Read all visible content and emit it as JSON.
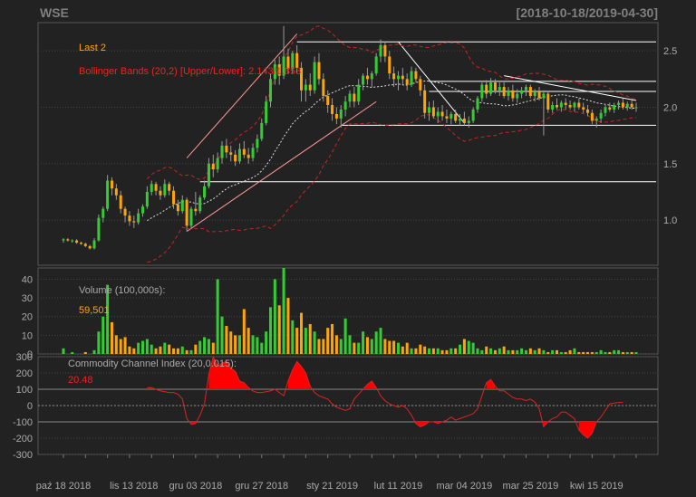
{
  "header": {
    "symbol": "WSE",
    "range": "[2018-10-18/2019-04-30]"
  },
  "colors": {
    "background": "#222222",
    "panel": "#222222",
    "grid": "#444444",
    "frame": "#555555",
    "text": "#aaaaaa",
    "up": "#33cc33",
    "down": "#ffa500",
    "bb": "#cc2222",
    "ma": "#dddddd",
    "label_orange": "#ffa500",
    "label_red": "#ee2222",
    "cci_fill": "#ff0000",
    "cci_line": "#dd2222",
    "trendline": "#ffffff"
  },
  "chart_data": [
    {
      "type": "candlestick",
      "panel": "price",
      "legend": {
        "last_label": "Last 2",
        "bb_label": "Bollinger Bands (20,2) [Upper/Lower]: 2.143/1.853"
      },
      "ylim": [
        0.6,
        2.75
      ],
      "yticks": [
        1.0,
        1.5,
        2.0,
        2.5
      ],
      "ytick_labels": [
        "1.0",
        "1.5",
        "2.0",
        "2.5"
      ],
      "hlines": [
        2.58,
        2.23,
        2.14,
        1.84,
        1.34
      ],
      "trend_lines": [
        {
          "x0": "2018-11-29",
          "y0": 1.55,
          "x1": "2019-01-09",
          "y1": 2.65
        },
        {
          "x0": "2018-11-29",
          "y0": 0.9,
          "x1": "2019-02-04",
          "y1": 2.05
        },
        {
          "x0": "2019-02-11",
          "y0": 2.58,
          "x1": "2019-03-04",
          "y1": 1.86
        },
        {
          "x0": "2019-03-15",
          "y0": 2.28,
          "x1": "2019-04-30",
          "y1": 2.06
        }
      ],
      "bars": [
        [
          "2018-10-18",
          0.82,
          0.84,
          0.8,
          0.83
        ],
        [
          "2018-10-19",
          0.83,
          0.84,
          0.81,
          0.82
        ],
        [
          "2018-10-22",
          0.82,
          0.83,
          0.8,
          0.82
        ],
        [
          "2018-10-23",
          0.82,
          0.83,
          0.79,
          0.8
        ],
        [
          "2018-10-24",
          0.8,
          0.81,
          0.78,
          0.79
        ],
        [
          "2018-10-25",
          0.79,
          0.8,
          0.76,
          0.77
        ],
        [
          "2018-10-26",
          0.77,
          0.78,
          0.74,
          0.75
        ],
        [
          "2018-10-29",
          0.75,
          0.84,
          0.74,
          0.82
        ],
        [
          "2018-10-30",
          0.82,
          1.05,
          0.81,
          1.02
        ],
        [
          "2018-10-31",
          1.02,
          1.12,
          0.98,
          1.1
        ],
        [
          "2018-11-02",
          1.1,
          1.4,
          1.08,
          1.35
        ],
        [
          "2018-11-05",
          1.35,
          1.38,
          1.22,
          1.28
        ],
        [
          "2018-11-06",
          1.28,
          1.32,
          1.18,
          1.22
        ],
        [
          "2018-11-07",
          1.22,
          1.26,
          1.06,
          1.1
        ],
        [
          "2018-11-08",
          1.1,
          1.12,
          0.98,
          1.04
        ],
        [
          "2018-11-09",
          1.04,
          1.08,
          0.95,
          0.99
        ],
        [
          "2018-11-13",
          0.99,
          1.04,
          0.93,
          0.98
        ],
        [
          "2018-11-14",
          0.98,
          1.1,
          0.96,
          1.06
        ],
        [
          "2018-11-15",
          1.06,
          1.14,
          1.03,
          1.12
        ],
        [
          "2018-11-16",
          1.12,
          1.3,
          1.1,
          1.25
        ],
        [
          "2018-11-19",
          1.25,
          1.35,
          1.22,
          1.32
        ],
        [
          "2018-11-20",
          1.32,
          1.34,
          1.22,
          1.26
        ],
        [
          "2018-11-21",
          1.26,
          1.3,
          1.18,
          1.22
        ],
        [
          "2018-11-22",
          1.22,
          1.36,
          1.2,
          1.32
        ],
        [
          "2018-11-23",
          1.32,
          1.34,
          1.22,
          1.26
        ],
        [
          "2018-11-26",
          1.26,
          1.3,
          1.1,
          1.14
        ],
        [
          "2018-11-27",
          1.14,
          1.18,
          1.04,
          1.08
        ],
        [
          "2018-11-28",
          1.08,
          1.22,
          1.06,
          1.18
        ],
        [
          "2018-11-29",
          1.18,
          1.2,
          0.9,
          0.95
        ],
        [
          "2018-11-30",
          0.95,
          1.12,
          0.92,
          1.1
        ],
        [
          "2018-12-03",
          1.1,
          1.25,
          1.04,
          1.08
        ],
        [
          "2018-12-04",
          1.08,
          1.22,
          1.06,
          1.2
        ],
        [
          "2018-12-05",
          1.2,
          1.35,
          1.18,
          1.3
        ],
        [
          "2018-12-06",
          1.3,
          1.55,
          1.28,
          1.5
        ],
        [
          "2018-12-07",
          1.5,
          1.58,
          1.38,
          1.45
        ],
        [
          "2018-12-10",
          1.45,
          1.6,
          1.42,
          1.55
        ],
        [
          "2018-12-11",
          1.55,
          1.7,
          1.5,
          1.66
        ],
        [
          "2018-12-12",
          1.66,
          1.72,
          1.55,
          1.6
        ],
        [
          "2018-12-13",
          1.6,
          1.66,
          1.52,
          1.58
        ],
        [
          "2018-12-14",
          1.58,
          1.62,
          1.48,
          1.52
        ],
        [
          "2018-12-17",
          1.52,
          1.68,
          1.5,
          1.63
        ],
        [
          "2018-12-18",
          1.63,
          1.7,
          1.55,
          1.58
        ],
        [
          "2018-12-19",
          1.58,
          1.64,
          1.5,
          1.55
        ],
        [
          "2018-12-20",
          1.55,
          1.68,
          1.52,
          1.64
        ],
        [
          "2018-12-21",
          1.64,
          1.76,
          1.6,
          1.72
        ],
        [
          "2018-12-27",
          1.72,
          1.9,
          1.7,
          1.86
        ],
        [
          "2018-12-28",
          1.86,
          2.1,
          1.84,
          2.05
        ],
        [
          "2018-12-31",
          2.05,
          2.3,
          2.0,
          2.25
        ],
        [
          "2019-01-02",
          2.25,
          2.42,
          2.2,
          2.38
        ],
        [
          "2019-01-03",
          2.38,
          2.45,
          2.2,
          2.28
        ],
        [
          "2019-01-04",
          2.28,
          2.72,
          2.25,
          2.45
        ],
        [
          "2019-01-07",
          2.45,
          2.52,
          2.3,
          2.34
        ],
        [
          "2019-01-08",
          2.34,
          2.5,
          2.3,
          2.48
        ],
        [
          "2019-01-09",
          2.48,
          2.55,
          2.3,
          2.35
        ],
        [
          "2019-01-10",
          2.35,
          2.4,
          2.05,
          2.15
        ],
        [
          "2019-01-11",
          2.15,
          2.25,
          2.05,
          2.2
        ],
        [
          "2019-01-14",
          2.2,
          2.3,
          2.1,
          2.15
        ],
        [
          "2019-01-15",
          2.15,
          2.45,
          2.12,
          2.4
        ],
        [
          "2019-01-16",
          2.4,
          2.48,
          2.2,
          2.25
        ],
        [
          "2019-01-17",
          2.25,
          2.3,
          2.05,
          2.1
        ],
        [
          "2019-01-18",
          2.1,
          2.15,
          1.95,
          2.02
        ],
        [
          "2019-01-21",
          2.02,
          2.08,
          1.88,
          1.94
        ],
        [
          "2019-01-22",
          1.94,
          2.0,
          1.85,
          1.9
        ],
        [
          "2019-01-23",
          1.9,
          2.02,
          1.82,
          1.98
        ],
        [
          "2019-01-24",
          1.98,
          2.1,
          1.92,
          2.05
        ],
        [
          "2019-01-25",
          2.05,
          2.15,
          2.0,
          2.12
        ],
        [
          "2019-01-28",
          2.12,
          2.18,
          2.0,
          2.05
        ],
        [
          "2019-01-29",
          2.05,
          2.25,
          2.02,
          2.2
        ],
        [
          "2019-01-30",
          2.2,
          2.3,
          2.15,
          2.28
        ],
        [
          "2019-01-31",
          2.28,
          2.35,
          2.2,
          2.25
        ],
        [
          "2019-02-01",
          2.25,
          2.32,
          2.18,
          2.3
        ],
        [
          "2019-02-04",
          2.3,
          2.48,
          2.28,
          2.45
        ],
        [
          "2019-02-05",
          2.45,
          2.6,
          2.4,
          2.55
        ],
        [
          "2019-02-06",
          2.55,
          2.58,
          2.4,
          2.45
        ],
        [
          "2019-02-07",
          2.45,
          2.5,
          2.25,
          2.3
        ],
        [
          "2019-02-08",
          2.3,
          2.36,
          2.18,
          2.25
        ],
        [
          "2019-02-11",
          2.25,
          2.32,
          2.15,
          2.28
        ],
        [
          "2019-02-12",
          2.28,
          2.35,
          2.2,
          2.25
        ],
        [
          "2019-02-13",
          2.25,
          2.3,
          2.15,
          2.2
        ],
        [
          "2019-02-14",
          2.2,
          2.36,
          2.18,
          2.32
        ],
        [
          "2019-02-15",
          2.32,
          2.35,
          2.22,
          2.25
        ],
        [
          "2019-02-18",
          2.25,
          2.28,
          2.1,
          2.15
        ],
        [
          "2019-02-19",
          2.15,
          2.2,
          1.9,
          1.95
        ],
        [
          "2019-02-20",
          1.95,
          2.05,
          1.88,
          2.0
        ],
        [
          "2019-02-21",
          2.0,
          2.06,
          1.9,
          1.92
        ],
        [
          "2019-02-22",
          1.92,
          2.0,
          1.86,
          1.96
        ],
        [
          "2019-02-25",
          1.96,
          2.02,
          1.88,
          1.92
        ],
        [
          "2019-02-26",
          1.92,
          1.98,
          1.86,
          1.9
        ],
        [
          "2019-02-27",
          1.9,
          1.96,
          1.85,
          1.94
        ],
        [
          "2019-02-28",
          1.94,
          1.98,
          1.86,
          1.88
        ],
        [
          "2019-03-01",
          1.88,
          1.94,
          1.84,
          1.9
        ],
        [
          "2019-03-04",
          1.9,
          1.96,
          1.84,
          1.86
        ],
        [
          "2019-03-05",
          1.86,
          1.92,
          1.82,
          1.88
        ],
        [
          "2019-03-06",
          1.88,
          2.0,
          1.86,
          1.98
        ],
        [
          "2019-03-07",
          1.98,
          2.1,
          1.95,
          2.08
        ],
        [
          "2019-03-08",
          2.08,
          2.22,
          2.05,
          2.2
        ],
        [
          "2019-03-11",
          2.2,
          2.24,
          2.08,
          2.12
        ],
        [
          "2019-03-12",
          2.12,
          2.26,
          2.1,
          2.22
        ],
        [
          "2019-03-13",
          2.22,
          2.25,
          2.12,
          2.15
        ],
        [
          "2019-03-14",
          2.15,
          2.22,
          2.1,
          2.18
        ],
        [
          "2019-03-15",
          2.18,
          2.22,
          2.08,
          2.1
        ],
        [
          "2019-03-18",
          2.1,
          2.18,
          2.06,
          2.15
        ],
        [
          "2019-03-19",
          2.15,
          2.2,
          2.05,
          2.08
        ],
        [
          "2019-03-20",
          2.08,
          2.16,
          2.04,
          2.12
        ],
        [
          "2019-03-21",
          2.12,
          2.18,
          2.08,
          2.15
        ],
        [
          "2019-03-22",
          2.15,
          2.2,
          2.1,
          2.18
        ],
        [
          "2019-03-25",
          2.18,
          2.2,
          2.08,
          2.1
        ],
        [
          "2019-03-26",
          2.1,
          2.16,
          2.05,
          2.14
        ],
        [
          "2019-03-27",
          2.14,
          2.18,
          2.06,
          2.08
        ],
        [
          "2019-03-28",
          2.08,
          2.15,
          1.75,
          2.12
        ],
        [
          "2019-03-29",
          2.12,
          2.14,
          1.95,
          1.98
        ],
        [
          "2019-04-01",
          1.98,
          2.05,
          1.95,
          2.02
        ],
        [
          "2019-04-02",
          2.02,
          2.08,
          1.98,
          2.0
        ],
        [
          "2019-04-03",
          2.0,
          2.06,
          1.96,
          2.04
        ],
        [
          "2019-04-04",
          2.04,
          2.08,
          1.98,
          2.02
        ],
        [
          "2019-04-05",
          2.02,
          2.06,
          1.98,
          2.0
        ],
        [
          "2019-04-08",
          2.0,
          2.05,
          1.96,
          2.04
        ],
        [
          "2019-04-09",
          2.04,
          2.08,
          1.98,
          2.0
        ],
        [
          "2019-04-10",
          2.0,
          2.04,
          1.95,
          1.98
        ],
        [
          "2019-04-11",
          1.98,
          2.02,
          1.92,
          1.95
        ],
        [
          "2019-04-12",
          1.95,
          1.98,
          1.85,
          1.88
        ],
        [
          "2019-04-15",
          1.88,
          1.92,
          1.82,
          1.9
        ],
        [
          "2019-04-16",
          1.9,
          1.98,
          1.86,
          1.95
        ],
        [
          "2019-04-17",
          1.95,
          2.02,
          1.92,
          2.0
        ],
        [
          "2019-04-18",
          2.0,
          2.04,
          1.96,
          1.98
        ],
        [
          "2019-04-23",
          1.98,
          2.04,
          1.95,
          2.02
        ],
        [
          "2019-04-24",
          2.02,
          2.06,
          1.98,
          2.04
        ],
        [
          "2019-04-25",
          2.04,
          2.08,
          1.98,
          2.0
        ],
        [
          "2019-04-26",
          2.0,
          2.05,
          1.97,
          2.03
        ],
        [
          "2019-04-29",
          2.03,
          2.06,
          1.98,
          2.0
        ],
        [
          "2019-04-30",
          2.0,
          2.04,
          1.96,
          2.0
        ]
      ]
    },
    {
      "type": "bar",
      "panel": "volume",
      "label": "Volume (100,000s):",
      "last_value": "59,501",
      "ylim": [
        0,
        46
      ],
      "yticks": [
        0,
        10,
        20,
        30,
        40
      ],
      "ytick_labels": [
        "0",
        "10",
        "20",
        "30",
        "40"
      ],
      "values": [
        3,
        0,
        1,
        0,
        0,
        1,
        0,
        2,
        12,
        20,
        37,
        17,
        10,
        8,
        9,
        4,
        3,
        6,
        7,
        8,
        5,
        3,
        4,
        6,
        5,
        3,
        3,
        4,
        2,
        2,
        5,
        7,
        9,
        8,
        6,
        40,
        20,
        15,
        12,
        10,
        10,
        24,
        14,
        10,
        9,
        6,
        12,
        25,
        40,
        26,
        46,
        30,
        18,
        14,
        22,
        14,
        16,
        12,
        8,
        8,
        14,
        16,
        10,
        8,
        19,
        10,
        6,
        6,
        12,
        9,
        8,
        12,
        14,
        8,
        7,
        7,
        6,
        4,
        6,
        3,
        3,
        5,
        4,
        3,
        3,
        3,
        2,
        2,
        3,
        3,
        5,
        8,
        7,
        6,
        3,
        2,
        4,
        3,
        2,
        3,
        4,
        2,
        2,
        2,
        3,
        2,
        3,
        2,
        3,
        2,
        1,
        2,
        2,
        1,
        1,
        2,
        3,
        1,
        1,
        1,
        1,
        1,
        2,
        1,
        1,
        2,
        2,
        1,
        1,
        1,
        1
      ]
    },
    {
      "type": "line",
      "panel": "cci",
      "label": "Commodity Channel Index (20,0.015):",
      "last_value": "20.48",
      "ylim": [
        -300,
        300
      ],
      "yticks": [
        -300,
        -200,
        -100,
        0,
        100,
        200,
        300
      ],
      "ytick_labels": [
        "-300",
        "-200",
        "-100",
        "0",
        "100",
        "200",
        "300"
      ],
      "hlines": [
        100,
        -100
      ],
      "x_labels": [
        "paź 18 2018",
        "lis 13 2018",
        "gru 03 2018",
        "gru 27 2018",
        "sty 21 2019",
        "lut 11 2019",
        "mar 04 2019",
        "mar 25 2019",
        "kwi 15 2019"
      ],
      "values": [
        null,
        null,
        null,
        null,
        null,
        null,
        null,
        null,
        null,
        null,
        null,
        null,
        null,
        null,
        null,
        null,
        null,
        null,
        null,
        110,
        110,
        100,
        90,
        85,
        80,
        80,
        70,
        40,
        -80,
        -115,
        -110,
        -60,
        10,
        190,
        300,
        240,
        260,
        270,
        230,
        210,
        150,
        140,
        110,
        90,
        80,
        80,
        85,
        90,
        100,
        80,
        60,
        150,
        220,
        270,
        240,
        200,
        120,
        80,
        60,
        50,
        40,
        10,
        -10,
        -20,
        -30,
        -20,
        40,
        70,
        100,
        130,
        150,
        110,
        60,
        30,
        10,
        0,
        -10,
        0,
        -20,
        -60,
        -110,
        -130,
        -120,
        -100,
        -100,
        -110,
        -100,
        -90,
        -70,
        -90,
        -80,
        -70,
        -60,
        -50,
        -20,
        60,
        140,
        160,
        120,
        90,
        90,
        70,
        50,
        40,
        40,
        30,
        40,
        20,
        -20,
        -130,
        -100,
        -80,
        -70,
        -40,
        -40,
        -60,
        -80,
        -150,
        -180,
        -200,
        -170,
        -100,
        -70,
        -30,
        10,
        15,
        18,
        20
      ]
    }
  ]
}
